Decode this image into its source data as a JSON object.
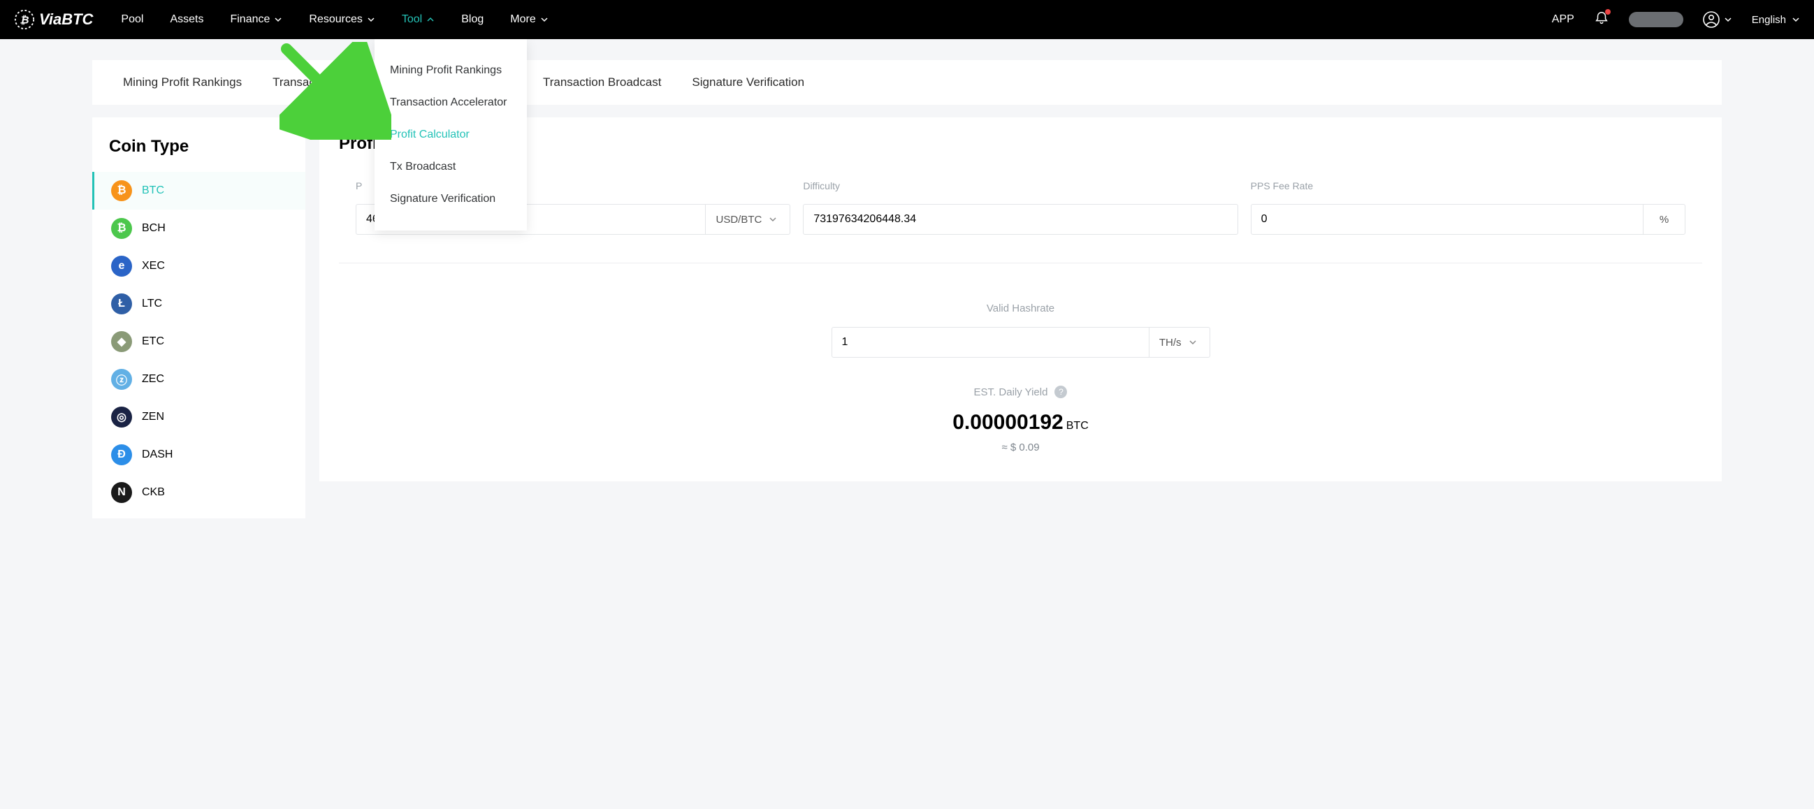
{
  "brand": "ViaBTC",
  "nav": {
    "pool": "Pool",
    "assets": "Assets",
    "finance": "Finance",
    "resources": "Resources",
    "tool": "Tool",
    "blog": "Blog",
    "more": "More"
  },
  "topRight": {
    "app": "APP",
    "language": "English"
  },
  "dropdown": {
    "mining_profit_rankings": "Mining Profit Rankings",
    "transaction_accelerator": "Transaction Accelerator",
    "profit_calculator": "Profit Calculator",
    "tx_broadcast": "Tx Broadcast",
    "signature_verification": "Signature Verification"
  },
  "subnav": {
    "mining_profit_rankings": "Mining Profit Rankings",
    "transaction_accelerator": "Transaction Accelerator",
    "transaction_broadcast": "Transaction Broadcast",
    "signature_verification": "Signature Verification"
  },
  "sidebar": {
    "title": "Coin Type",
    "coins": [
      {
        "sym": "BTC",
        "bg": "#f7931a",
        "glyph": "₿"
      },
      {
        "sym": "BCH",
        "bg": "#4cc74c",
        "glyph": "₿"
      },
      {
        "sym": "XEC",
        "bg": "#2a64c7",
        "glyph": "e"
      },
      {
        "sym": "LTC",
        "bg": "#2f5fa6",
        "glyph": "Ł"
      },
      {
        "sym": "ETC",
        "bg": "#8a9a77",
        "glyph": "◆"
      },
      {
        "sym": "ZEC",
        "bg": "#62b0e5",
        "glyph": "ⓩ"
      },
      {
        "sym": "ZEN",
        "bg": "#1a2344",
        "glyph": "◎"
      },
      {
        "sym": "DASH",
        "bg": "#2c8ee8",
        "glyph": "Đ"
      },
      {
        "sym": "CKB",
        "bg": "#1a1a1a",
        "glyph": "N"
      }
    ]
  },
  "main": {
    "title": "Profit",
    "labels": {
      "price": "P",
      "difficulty": "Difficulty",
      "pps_fee_rate": "PPS Fee Rate",
      "valid_hashrate": "Valid Hashrate",
      "est_daily_yield": "EST. Daily Yield"
    },
    "values": {
      "price": "46121.43",
      "price_unit": "USD/BTC",
      "difficulty": "73197634206448.34",
      "pps": "0",
      "pps_unit": "%",
      "hashrate": "1",
      "hashrate_unit": "TH/s",
      "yield_amount": "0.00000192",
      "yield_unit": "BTC",
      "yield_approx": "≈ $ 0.09"
    }
  }
}
